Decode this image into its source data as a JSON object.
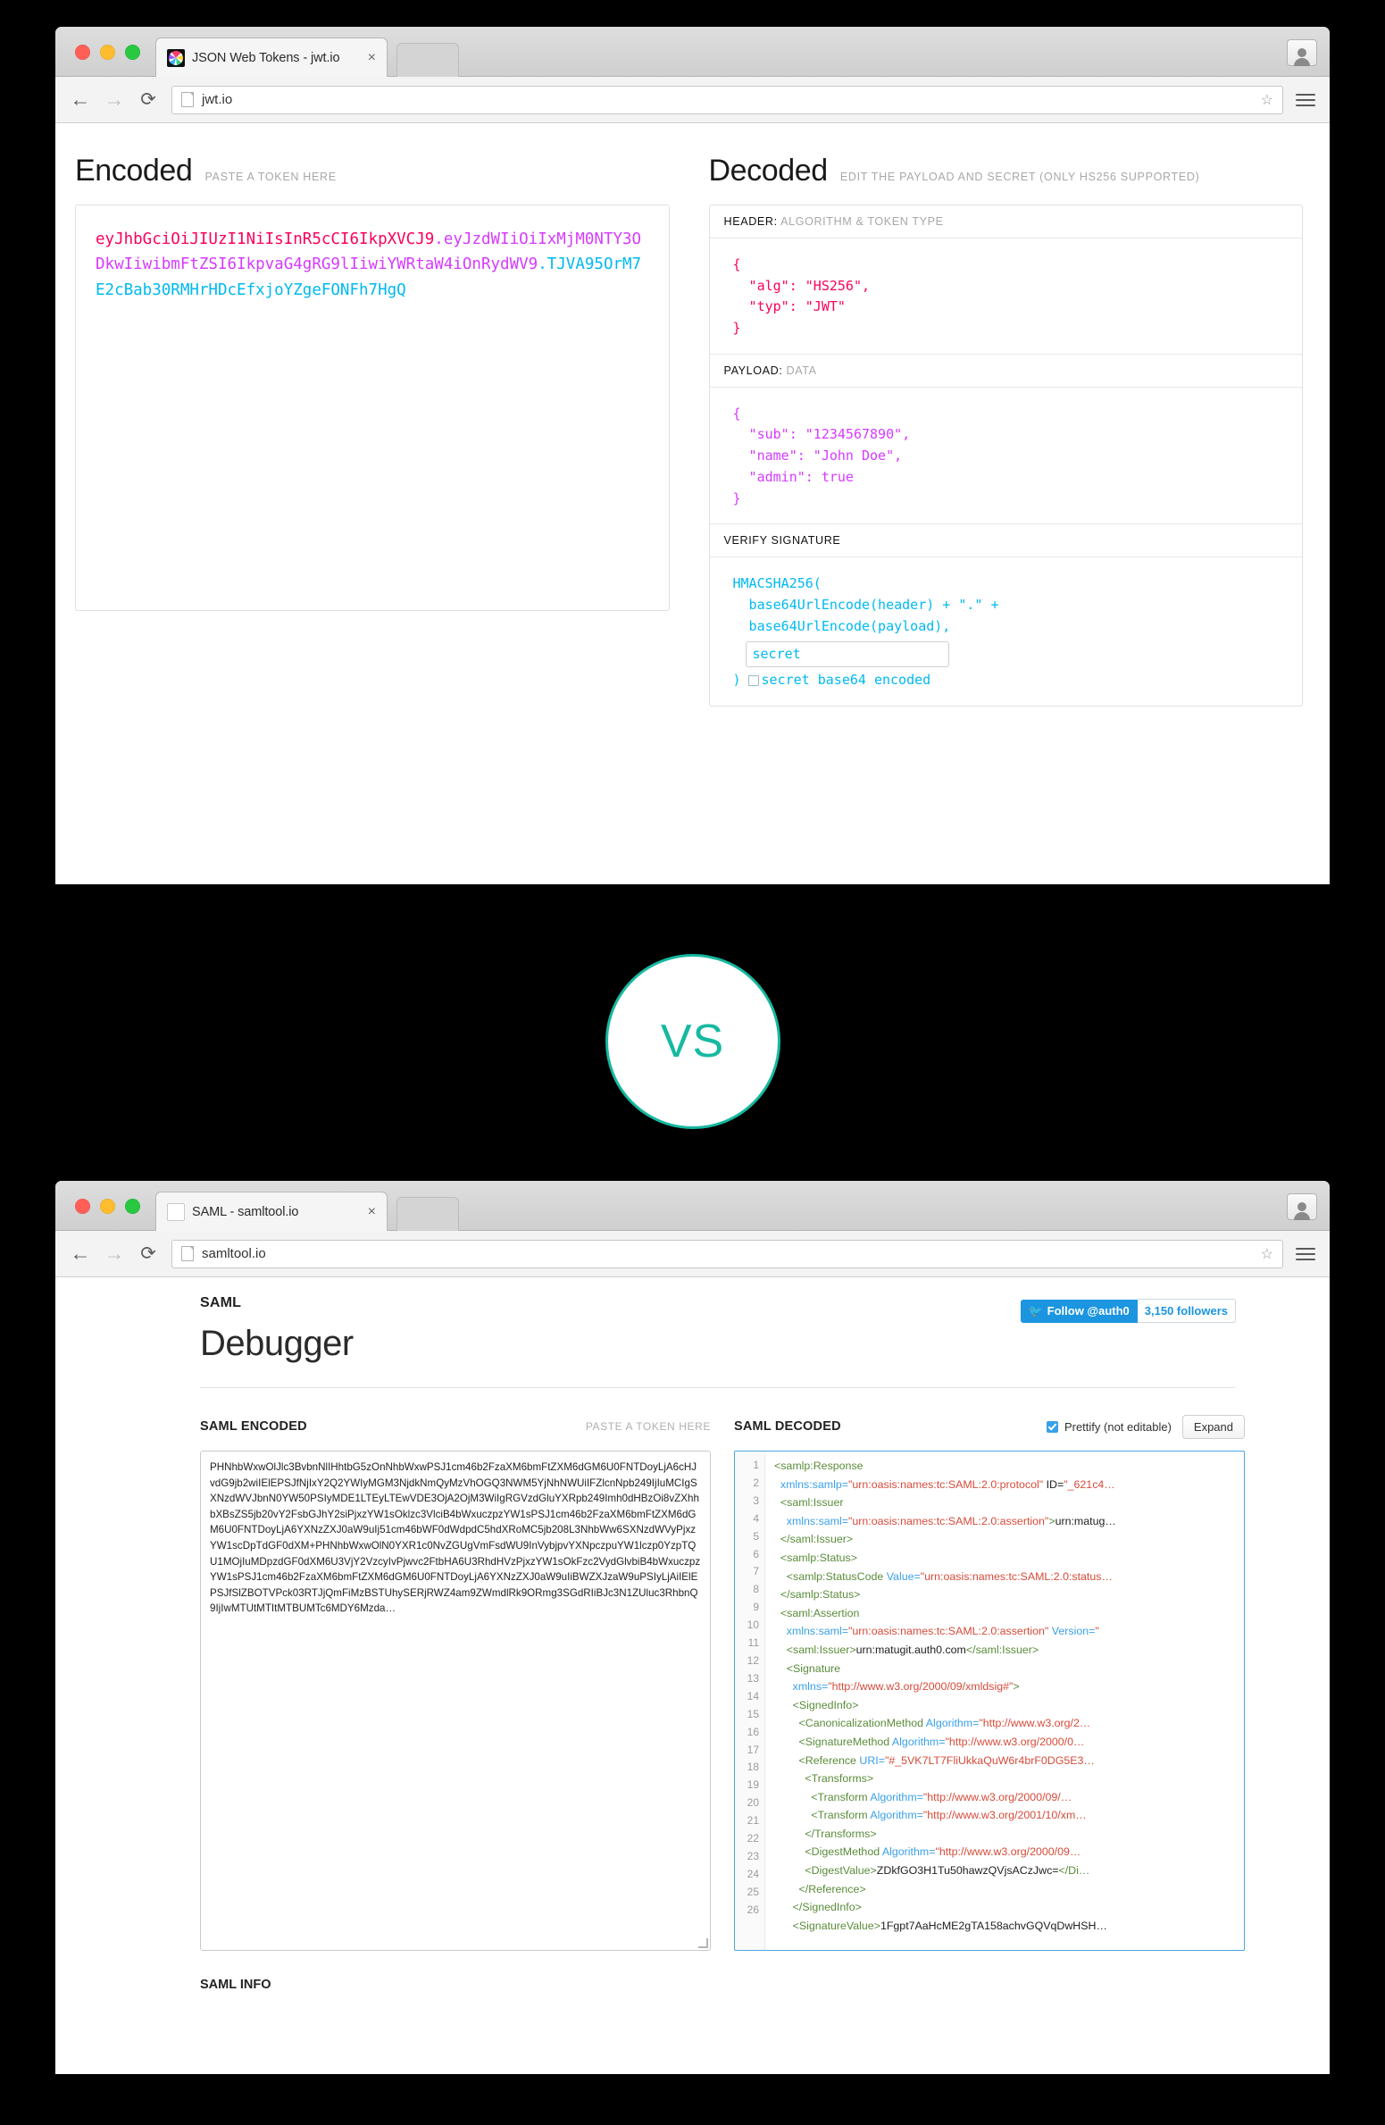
{
  "jwt_window": {
    "tab": {
      "title": "JSON Web Tokens - jwt.io",
      "close": "×",
      "favicon": "jwt-logo-icon"
    },
    "url": "jwt.io",
    "nav": {
      "back": "←",
      "forward": "→",
      "reload": "⟳",
      "star": "☆"
    },
    "encoded": {
      "title": "Encoded",
      "subtitle": "PASTE A TOKEN HERE",
      "token_header": "eyJhbGciOiJIUzI1NiIsInR5cCI6IkpXVCJ9",
      "token_payload": "eyJzdWIiOiIxMjM0NTY3ODkwIiwibmFtZSI6IkpvaG4gRG9lIiwiYWRtaW4iOnRydWV9",
      "token_signature": "TJVA95OrM7E2cBab30RMHrHDcEfxjoYZgeFONFh7HgQ",
      "dot": "."
    },
    "decoded": {
      "title": "Decoded",
      "subtitle": "EDIT THE PAYLOAD AND SECRET (ONLY HS256 SUPPORTED)",
      "header_label": "HEADER:",
      "header_label_muted": "ALGORITHM & TOKEN TYPE",
      "header_json": "{\n  \"alg\": \"HS256\",\n  \"typ\": \"JWT\"\n}",
      "payload_label": "PAYLOAD:",
      "payload_label_muted": "DATA",
      "payload_json": "{\n  \"sub\": \"1234567890\",\n  \"name\": \"John Doe\",\n  \"admin\": true\n}",
      "signature_label": "VERIFY SIGNATURE",
      "sig_line1": "HMACSHA256(",
      "sig_line2": "  base64UrlEncode(header) + \".\" +",
      "sig_line3": "  base64UrlEncode(payload),",
      "secret_value": "secret",
      "secret_placeholder": "secret",
      "sig_close": ")",
      "base64_checkbox_label": "secret base64 encoded"
    }
  },
  "vs_badge": {
    "label": "VS",
    "color": "#16b9a0"
  },
  "saml_window": {
    "tab": {
      "title": "SAML - samltool.io",
      "close": "×",
      "favicon": "page-icon"
    },
    "url": "samltool.io",
    "nav": {
      "back": "←",
      "forward": "→",
      "reload": "⟳",
      "star": "☆"
    },
    "brand": "SAML",
    "page_title": "Debugger",
    "twitter": {
      "follow_label": "Follow @auth0",
      "followers": "3,150 followers"
    },
    "encoded": {
      "label": "SAML ENCODED",
      "hint": "PASTE A TOKEN HERE",
      "token": "PHNhbWxwOlJlc3BvbnNlIHhtbG5zOnNhbWxwPSJ1cm46b2FzaXM6bmFtZXM6dGM6U0FNTDoyLjA6cHJvdG9jb2wiIElEPSJfNjIxY2Q2YWIyMGM3NjdkNmQyMzVhOGQ3NWM5YjNhNWUiIFZlcnNpb249IjIuMCIgSXNzdWVJbnN0YW50PSIyMDE1LTEyLTEwVDE3OjA2OjM3WiIgRGVzdGluYXRpb249Imh0dHBzOi8vZXhhbXBsZS5jb20vY2FsbGJhY2siPjxzYW1sOklzc3VlciB4bWxuczpzYW1sPSJ1cm46b2FzaXM6bmFtZXM6dGM6U0FNTDoyLjA6YXNzZXJ0aW9uIj51cm46bWF0dWdpdC5hdXRoMC5jb208L3NhbWw6SXNzdWVyPjxzYW1scDpTdGF0dXM+PHNhbWxwOlN0YXR1c0NvZGUgVmFsdWU9InVybjpvYXNpczpuYW1lczp0YzpTQU1MOjIuMDpzdGF0dXM6U3VjY2VzcyIvPjwvc2FtbHA6U3RhdHVzPjxzYW1sOkFzc2VydGlvbiB4bWxuczpzYW1sPSJ1cm46b2FzaXM6bmFtZXM6dGM6U0FNTDoyLjA6YXNzZXJ0aW9uIiBWZXJzaW9uPSIyLjAiIElEPSJfSlZBOTVPck03RTJjQmFiMzBSTUhySERjRWZ4am9ZWmdlRk9ORmg3SGdRIiBJc3N1ZUluc3RhbnQ9IjIwMTUtMTItMTBUMTc6MDY6Mzda…"
    },
    "decoded": {
      "label": "SAML DECODED",
      "prettify_label": "Prettify (not editable)",
      "expand_label": "Expand",
      "lines": [
        {
          "n": "1",
          "parts": [
            {
              "t": "tag",
              "v": "<samlp:Response"
            }
          ]
        },
        {
          "n": "2",
          "parts": [
            {
              "t": "attr",
              "v": "  xmlns:samlp="
            },
            {
              "t": "val",
              "v": "\"urn:oasis:names:tc:SAML:2.0:protocol\""
            },
            {
              "t": "text",
              "v": " ID="
            },
            {
              "t": "val",
              "v": "\"_621c4…"
            }
          ]
        },
        {
          "n": "3",
          "parts": [
            {
              "t": "tag",
              "v": "  <saml:Issuer"
            }
          ]
        },
        {
          "n": "4",
          "parts": [
            {
              "t": "attr",
              "v": "    xmlns:saml="
            },
            {
              "t": "val",
              "v": "\"urn:oasis:names:tc:SAML:2.0:assertion\""
            },
            {
              "t": "tag",
              "v": ">"
            },
            {
              "t": "text",
              "v": "urn:matug…"
            }
          ]
        },
        {
          "n": "5",
          "parts": [
            {
              "t": "tag",
              "v": "  </saml:Issuer>"
            }
          ]
        },
        {
          "n": "6",
          "parts": [
            {
              "t": "tag",
              "v": "  <samlp:Status>"
            }
          ]
        },
        {
          "n": "7",
          "parts": [
            {
              "t": "tag",
              "v": "    <samlp:StatusCode "
            },
            {
              "t": "attr",
              "v": "Value="
            },
            {
              "t": "val",
              "v": "\"urn:oasis:names:tc:SAML:2.0:status…"
            }
          ]
        },
        {
          "n": "8",
          "parts": [
            {
              "t": "tag",
              "v": "  </samlp:Status>"
            }
          ]
        },
        {
          "n": "9",
          "parts": [
            {
              "t": "tag",
              "v": "  <saml:Assertion"
            }
          ]
        },
        {
          "n": "10",
          "parts": [
            {
              "t": "attr",
              "v": "    xmlns:saml="
            },
            {
              "t": "val",
              "v": "\"urn:oasis:names:tc:SAML:2.0:assertion\""
            },
            {
              "t": "text",
              "v": " "
            },
            {
              "t": "attr",
              "v": "Version="
            },
            {
              "t": "val",
              "v": "\""
            }
          ]
        },
        {
          "n": "11",
          "parts": [
            {
              "t": "tag",
              "v": "    <saml:Issuer>"
            },
            {
              "t": "text",
              "v": "urn:matugit.auth0.com"
            },
            {
              "t": "tag",
              "v": "</saml:Issuer>"
            }
          ]
        },
        {
          "n": "12",
          "parts": [
            {
              "t": "tag",
              "v": "    <Signature"
            }
          ]
        },
        {
          "n": "13",
          "parts": [
            {
              "t": "attr",
              "v": "      xmlns="
            },
            {
              "t": "val",
              "v": "\"http://www.w3.org/2000/09/xmldsig#\""
            },
            {
              "t": "tag",
              "v": ">"
            }
          ]
        },
        {
          "n": "14",
          "parts": [
            {
              "t": "tag",
              "v": "      <SignedInfo>"
            }
          ]
        },
        {
          "n": "15",
          "parts": [
            {
              "t": "tag",
              "v": "        <CanonicalizationMethod "
            },
            {
              "t": "attr",
              "v": "Algorithm="
            },
            {
              "t": "val",
              "v": "\"http://www.w3.org/2…"
            }
          ]
        },
        {
          "n": "16",
          "parts": [
            {
              "t": "tag",
              "v": "        <SignatureMethod "
            },
            {
              "t": "attr",
              "v": "Algorithm="
            },
            {
              "t": "val",
              "v": "\"http://www.w3.org/2000/0…"
            }
          ]
        },
        {
          "n": "17",
          "parts": [
            {
              "t": "tag",
              "v": "        <Reference "
            },
            {
              "t": "attr",
              "v": "URI="
            },
            {
              "t": "val",
              "v": "\"#_5VK7LT7FliUkkaQuW6r4brF0DG5E3…"
            }
          ]
        },
        {
          "n": "18",
          "parts": [
            {
              "t": "tag",
              "v": "          <Transforms>"
            }
          ]
        },
        {
          "n": "19",
          "parts": [
            {
              "t": "tag",
              "v": "            <Transform "
            },
            {
              "t": "attr",
              "v": "Algorithm="
            },
            {
              "t": "val",
              "v": "\"http://www.w3.org/2000/09/…"
            }
          ]
        },
        {
          "n": "20",
          "parts": [
            {
              "t": "tag",
              "v": "            <Transform "
            },
            {
              "t": "attr",
              "v": "Algorithm="
            },
            {
              "t": "val",
              "v": "\"http://www.w3.org/2001/10/xm…"
            }
          ]
        },
        {
          "n": "21",
          "parts": [
            {
              "t": "tag",
              "v": "          </Transforms>"
            }
          ]
        },
        {
          "n": "22",
          "parts": [
            {
              "t": "tag",
              "v": "          <DigestMethod "
            },
            {
              "t": "attr",
              "v": "Algorithm="
            },
            {
              "t": "val",
              "v": "\"http://www.w3.org/2000/09…"
            }
          ]
        },
        {
          "n": "23",
          "parts": [
            {
              "t": "tag",
              "v": "          <DigestValue>"
            },
            {
              "t": "text",
              "v": "ZDkfGO3H1Tu50hawzQVjsACzJwc="
            },
            {
              "t": "tag",
              "v": "</Di…"
            }
          ]
        },
        {
          "n": "24",
          "parts": [
            {
              "t": "tag",
              "v": "        </Reference>"
            }
          ]
        },
        {
          "n": "25",
          "parts": [
            {
              "t": "tag",
              "v": "      </SignedInfo>"
            }
          ]
        },
        {
          "n": "26",
          "parts": [
            {
              "t": "tag",
              "v": "      <SignatureValue>"
            },
            {
              "t": "text",
              "v": "1Fgpt7AaHcME2gTA158achvGQVqDwHSH…"
            }
          ]
        }
      ]
    },
    "info_label": "SAML INFO"
  }
}
